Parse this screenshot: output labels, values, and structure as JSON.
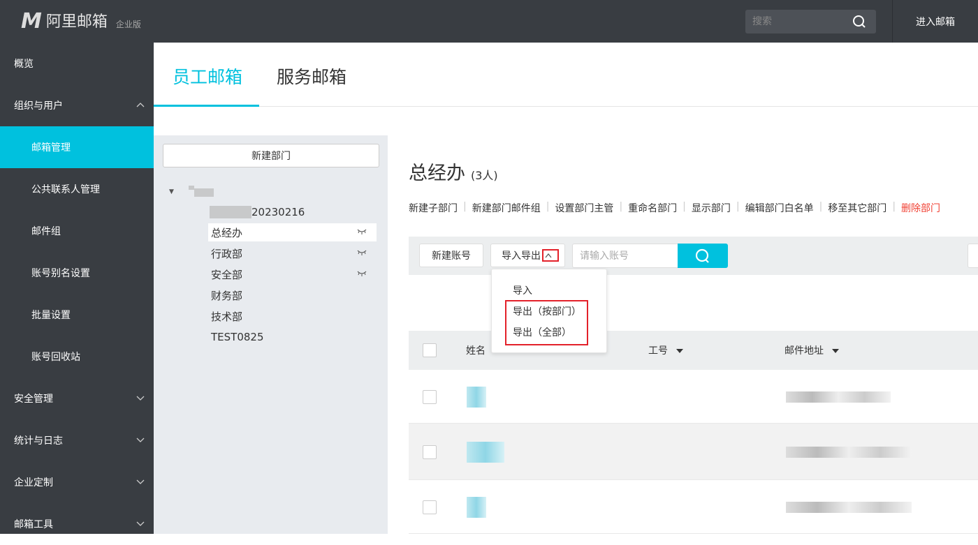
{
  "header": {
    "logo_mark": "M",
    "logo_text": "阿里邮箱",
    "edition": "企业版",
    "search_placeholder": "搜索",
    "enter_mail": "进入邮箱"
  },
  "sidebar": {
    "items": [
      {
        "label": "概览",
        "level": 1
      },
      {
        "label": "组织与用户",
        "level": 1,
        "chevron": "up"
      },
      {
        "label": "邮箱管理",
        "level": 2,
        "active": true
      },
      {
        "label": "公共联系人管理",
        "level": 2
      },
      {
        "label": "邮件组",
        "level": 2
      },
      {
        "label": "账号别名设置",
        "level": 2
      },
      {
        "label": "批量设置",
        "level": 2
      },
      {
        "label": "账号回收站",
        "level": 2
      },
      {
        "label": "安全管理",
        "level": 1,
        "chevron": "down"
      },
      {
        "label": "统计与日志",
        "level": 1,
        "chevron": "down"
      },
      {
        "label": "企业定制",
        "level": 1,
        "chevron": "down"
      },
      {
        "label": "邮箱工具",
        "level": 1,
        "chevron": "down"
      }
    ]
  },
  "tabs": [
    {
      "label": "员工邮箱",
      "active": true
    },
    {
      "label": "服务邮箱"
    }
  ],
  "tree": {
    "new_dept": "新建部门",
    "child_suffix": "20230216",
    "nodes": [
      {
        "label": "总经办",
        "selected": true,
        "hidden_icon": true
      },
      {
        "label": "行政部",
        "hidden_icon": true
      },
      {
        "label": "安全部",
        "hidden_icon": true
      },
      {
        "label": "财务部"
      },
      {
        "label": "技术部"
      },
      {
        "label": "TEST0825"
      }
    ]
  },
  "dept": {
    "title": "总经办",
    "count": "(3人)",
    "actions": [
      "新建子部门",
      "新建部门邮件组",
      "设置部门主管",
      "重命名部门",
      "显示部门",
      "编辑部门白名单",
      "移至其它部门"
    ],
    "danger_action": "删除部门"
  },
  "toolbar": {
    "new_account": "新建账号",
    "import_export": "导入导出",
    "search_placeholder": "请输入账号"
  },
  "menu": {
    "items": [
      "导入",
      "导出（按部门）",
      "导出（全部）"
    ]
  },
  "table": {
    "columns": [
      "姓名",
      "工号",
      "邮件地址"
    ]
  },
  "colors": {
    "accent": "#00c1de",
    "danger": "#f04134",
    "highlight": "#e3212a",
    "dark": "#393d42"
  }
}
